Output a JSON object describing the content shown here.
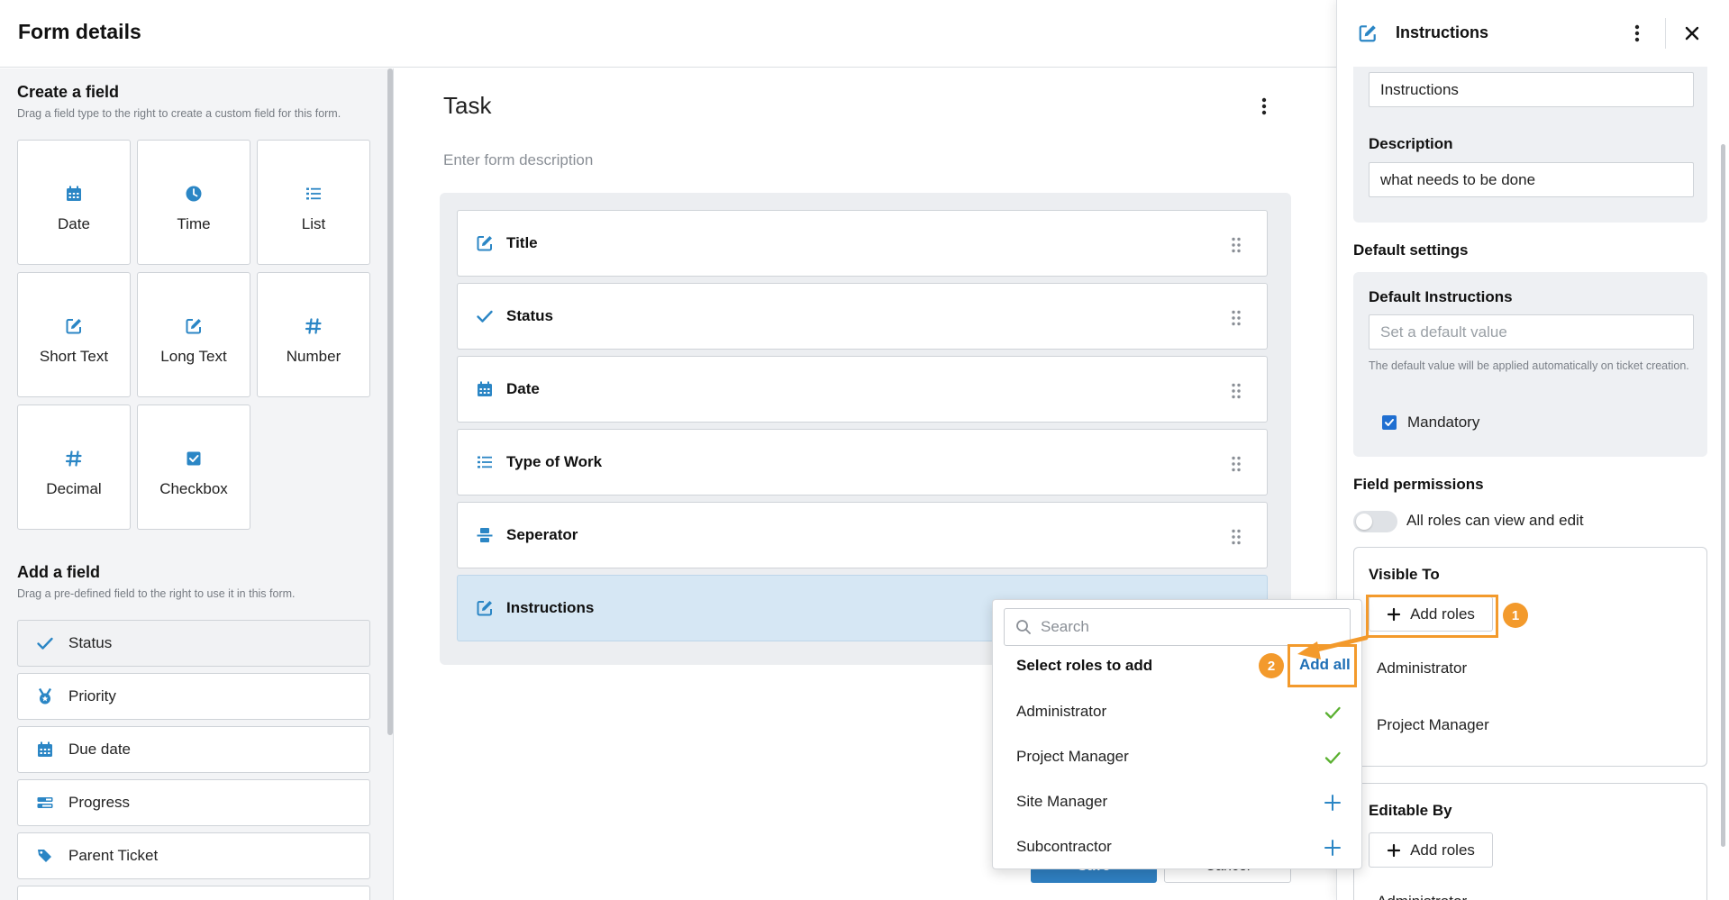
{
  "header": {
    "title": "Form details"
  },
  "sidebar": {
    "create_title": "Create a field",
    "create_subtitle": "Drag a field type to the right to create a custom field for this form.",
    "field_types": [
      {
        "label": "Date",
        "icon": "calendar-icon"
      },
      {
        "label": "Time",
        "icon": "clock-icon"
      },
      {
        "label": "List",
        "icon": "list-icon"
      },
      {
        "label": "Short Text",
        "icon": "edit-icon"
      },
      {
        "label": "Long Text",
        "icon": "edit-icon"
      },
      {
        "label": "Number",
        "icon": "hash-icon"
      },
      {
        "label": "Decimal",
        "icon": "hash-icon"
      },
      {
        "label": "Checkbox",
        "icon": "checkbox-icon"
      }
    ],
    "add_title": "Add a field",
    "add_subtitle": "Drag a pre-defined field to the right to use it in this form.",
    "predefined_fields": [
      {
        "label": "Status",
        "icon": "check-icon"
      },
      {
        "label": "Priority",
        "icon": "medal-icon"
      },
      {
        "label": "Due date",
        "icon": "calendar-icon"
      },
      {
        "label": "Progress",
        "icon": "progress-icon"
      },
      {
        "label": "Parent Ticket",
        "icon": "tag-icon"
      }
    ]
  },
  "form": {
    "name": "Task",
    "description_placeholder": "Enter form description",
    "fields": [
      {
        "label": "Title",
        "icon": "edit-icon"
      },
      {
        "label": "Status",
        "icon": "check-icon"
      },
      {
        "label": "Date",
        "icon": "calendar-icon"
      },
      {
        "label": "Type of Work",
        "icon": "list-icon"
      },
      {
        "label": "Seperator",
        "icon": "separator-icon"
      },
      {
        "label": "Instructions",
        "icon": "edit-icon"
      }
    ],
    "save_label": "Save",
    "cancel_label": "Cancel"
  },
  "panel": {
    "title": "Instructions",
    "name_value": "Instructions",
    "description_label": "Description",
    "description_value": "what needs to be done",
    "default_settings_title": "Default settings",
    "default_label": "Default Instructions",
    "default_placeholder": "Set a default value",
    "default_hint": "The default value will be applied automatically on ticket creation.",
    "mandatory_label": "Mandatory",
    "permissions_title": "Field permissions",
    "all_roles_label": "All roles can view and edit",
    "visible_to_label": "Visible To",
    "add_roles_label": "Add roles",
    "visible_roles": [
      "Administrator",
      "Project Manager"
    ],
    "editable_by_label": "Editable By",
    "editable_roles": [
      "Administrator"
    ]
  },
  "dropdown": {
    "search_placeholder": "Search",
    "header": "Select roles to add",
    "add_all_label": "Add all",
    "roles": [
      {
        "name": "Administrator",
        "state": "added"
      },
      {
        "name": "Project Manager",
        "state": "added"
      },
      {
        "name": "Site Manager",
        "state": "available"
      },
      {
        "name": "Subcontractor",
        "state": "available"
      }
    ]
  },
  "annotations": {
    "step1": "1",
    "step2": "2"
  },
  "colors": {
    "accent": "#2f7fc1",
    "icon_blue": "#2b86c5",
    "added_check": "#5ab030",
    "annotation_orange": "#f39a2c",
    "active_field_bg": "#d6e7f4"
  }
}
